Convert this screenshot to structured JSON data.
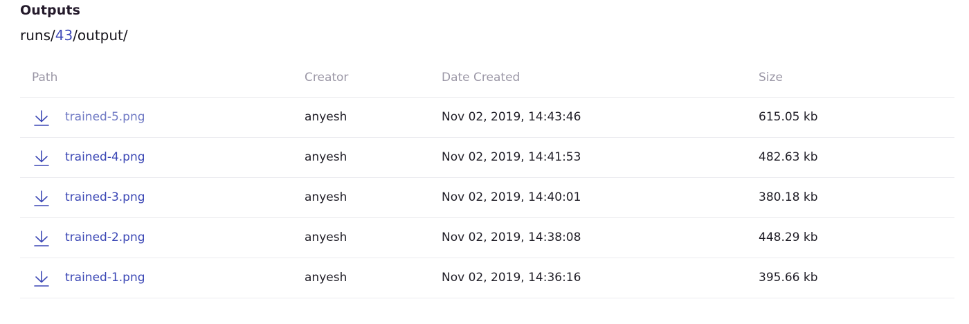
{
  "header": {
    "title": "Outputs",
    "breadcrumb": {
      "prefix": "runs/",
      "run_id": "43",
      "suffix": "/output/"
    }
  },
  "table": {
    "columns": {
      "path": "Path",
      "creator": "Creator",
      "date": "Date Created",
      "size": "Size"
    },
    "rows": [
      {
        "path": "trained-5.png",
        "creator": "anyesh",
        "date": "Nov 02, 2019, 14:43:46",
        "size": "615.05 kb"
      },
      {
        "path": "trained-4.png",
        "creator": "anyesh",
        "date": "Nov 02, 2019, 14:41:53",
        "size": "482.63 kb"
      },
      {
        "path": "trained-3.png",
        "creator": "anyesh",
        "date": "Nov 02, 2019, 14:40:01",
        "size": "380.18 kb"
      },
      {
        "path": "trained-2.png",
        "creator": "anyesh",
        "date": "Nov 02, 2019, 14:38:08",
        "size": "448.29 kb"
      },
      {
        "path": "trained-1.png",
        "creator": "anyesh",
        "date": "Nov 02, 2019, 14:36:16",
        "size": "395.66 kb"
      }
    ]
  },
  "icons": {
    "download": "download-icon"
  },
  "colors": {
    "link": "#3b47b5",
    "link_hover": "#6f79c4",
    "header_text": "#9b97a6",
    "divider": "#ebebef"
  }
}
